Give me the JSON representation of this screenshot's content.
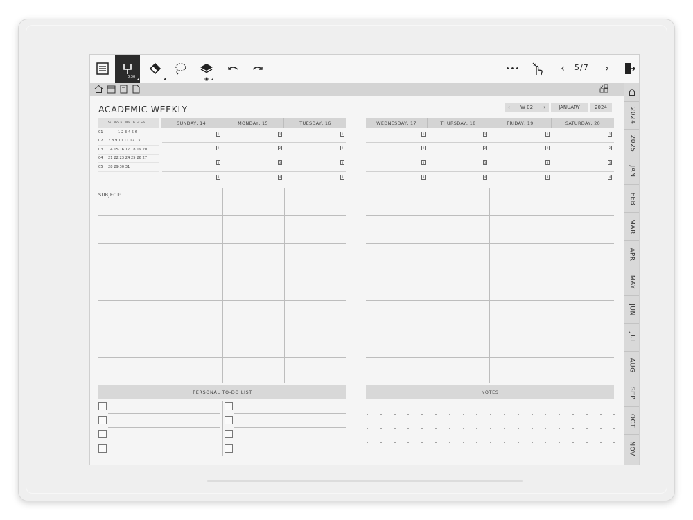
{
  "toolbar": {
    "pen_size": "0.30",
    "page_indicator": "5/7",
    "more": "•••"
  },
  "planner": {
    "title": "ACADEMIC WEEKLY",
    "week_label": "W 02",
    "month_label": "JANUARY",
    "year_label": "2024",
    "days_left": [
      "SUNDAY, 14",
      "MONDAY, 15",
      "TUESDAY, 16"
    ],
    "days_right": [
      "WEDNESDAY, 17",
      "THURSDAY, 18",
      "FRIDAY, 19",
      "SATURDAY, 20"
    ],
    "mini_calendar": {
      "header": "Su Mo Tu We Th Fr Sa",
      "rows": [
        {
          "week": "01",
          "days": "1  2  3  4  5  6"
        },
        {
          "week": "02",
          "days": "7  8  9  10 11 12 13"
        },
        {
          "week": "03",
          "days": "14 15 16 17 18 19 20"
        },
        {
          "week": "04",
          "days": "21 22 23 24 25 26 27"
        },
        {
          "week": "05",
          "days": "28 29 30 31"
        }
      ]
    },
    "period_icons": [
      "1",
      "2",
      "3",
      "4"
    ],
    "subject_label": "SUBJECT:",
    "todo_title": "PERSONAL TO-DO LIST",
    "notes_title": "NOTES"
  },
  "side_tabs": [
    "2024",
    "2025",
    "JAN",
    "FEB",
    "MAR",
    "APR",
    "MAY",
    "JUN",
    "JUL",
    "AUG",
    "SEP",
    "OCT",
    "NOV"
  ]
}
